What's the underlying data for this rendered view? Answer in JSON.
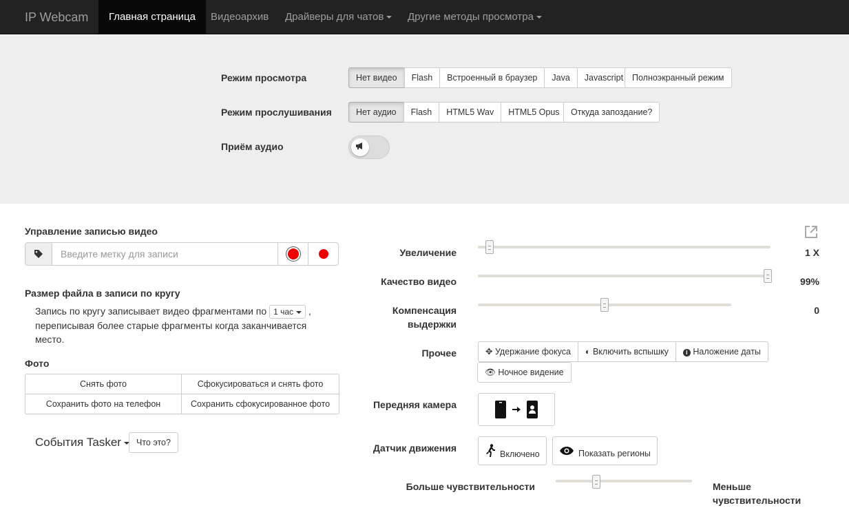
{
  "navbar": {
    "brand": "IP Webcam",
    "items": [
      {
        "label": "Главная страница",
        "active": true
      },
      {
        "label": "Видеоархив",
        "active": false
      },
      {
        "label": "Драйверы для чатов",
        "active": false,
        "dropdown": true
      },
      {
        "label": "Другие методы просмотра",
        "active": false,
        "dropdown": true
      }
    ]
  },
  "view_mode": {
    "label": "Режим просмотра",
    "options": [
      "Нет видео",
      "Flash",
      "Встроенный в браузер",
      "Java",
      "Javascript"
    ],
    "selected": "Нет видео",
    "fullscreen": "Полноэкранный режим"
  },
  "listen_mode": {
    "label": "Режим прослушивания",
    "options": [
      "Нет аудио",
      "Flash",
      "HTML5 Wav",
      "HTML5 Opus"
    ],
    "selected": "Нет аудио",
    "delay_help": "Откуда запоздание?"
  },
  "audio_receive": {
    "label": "Приём аудио",
    "enabled": false
  },
  "recording": {
    "title": "Управление записью видео",
    "placeholder": "Введите метку для записи"
  },
  "loop": {
    "title": "Размер файла в записи по кругу",
    "text_before": "Запись по кругу записывает видео фрагментами по",
    "select_value": "1 час",
    "text_after": ",",
    "text_line2": "переписывая более старые фрагменты когда заканчивается",
    "text_line3": "место."
  },
  "photo": {
    "title": "Фото",
    "buttons": [
      "Снять фото",
      "Сфокусироваться и снять фото",
      "Сохранить фото на телефон",
      "Сохранить сфокусированное фото"
    ]
  },
  "tasker": {
    "label": "События Tasker",
    "help": "Что это?"
  },
  "controls": {
    "zoom": {
      "label": "Увеличение",
      "value": "1 X",
      "level": 0.04
    },
    "quality": {
      "label": "Качество видео",
      "value": "99%",
      "level": 0.99
    },
    "exposure": {
      "label_line1": "Компенсация",
      "label_line2": "выдержки",
      "value": "0",
      "level": 0.5
    },
    "misc": {
      "label": "Прочее",
      "buttons": [
        "Удержание фокуса",
        "Включить вспышку",
        "Наложение даты",
        "Ночное видение"
      ]
    },
    "front_camera": {
      "label": "Передняя камера"
    },
    "motion": {
      "label": "Датчик движения",
      "enabled_label": "Включено",
      "regions_label": "Показать регионы"
    },
    "sensitivity": {
      "more": "Больше чувствительности",
      "less_line1": "Меньше",
      "less_line2": "чувствительности",
      "level": 0.3
    }
  }
}
